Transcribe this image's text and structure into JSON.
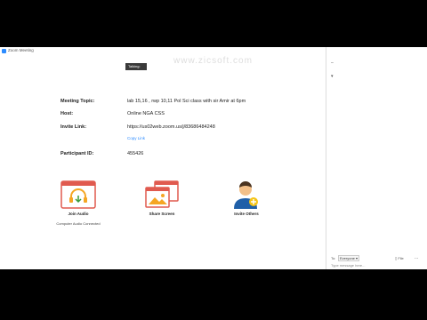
{
  "window": {
    "title": "Zoom Meeting"
  },
  "tooltip": "Talking:",
  "watermark": "www.zicsoft.com",
  "meeting": {
    "topic_label": "Meeting Topic:",
    "topic_value": "lab 15,16 , rwp 10,11 Pol Sci class with sir Amir at 6pm",
    "host_label": "Host:",
    "host_value": "Online NGA CSS",
    "invite_label": "Invite Link:",
    "invite_value": "https://us02web.zoom.us/j/83686484248",
    "copy_link": "Copy Link",
    "pid_label": "Participant ID:",
    "pid_value": "455426"
  },
  "actions": {
    "join_audio": "Join Audio",
    "join_audio_sub": "Computer Audio Connected",
    "share_screen": "Share Screen",
    "invite_others": "Invite Others"
  },
  "chat": {
    "to_label": "To:",
    "recipient": "Everyone ▾",
    "file_label": "File",
    "more": "...",
    "placeholder": "Type message here..."
  },
  "colors": {
    "accent": "#2d8cff",
    "icon_red": "#e05a4f",
    "icon_orange": "#f5a623"
  }
}
